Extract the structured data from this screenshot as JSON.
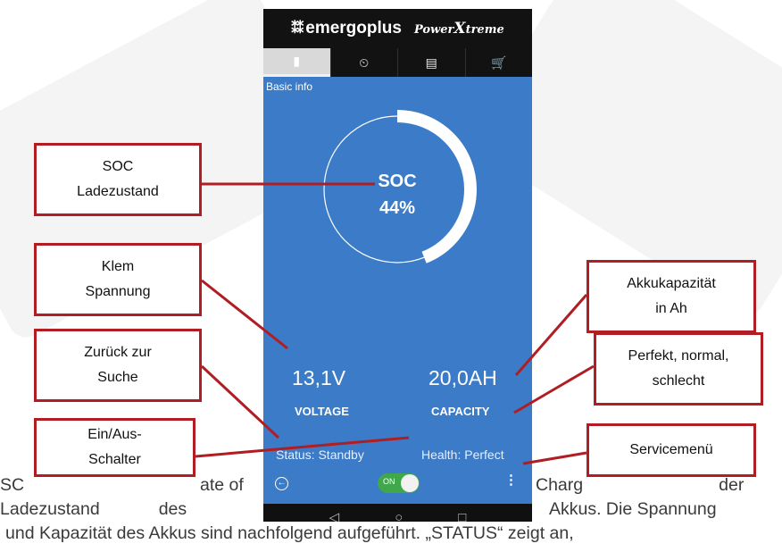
{
  "app": {
    "brand": "emergoplus",
    "brand_product_prefix": "Power",
    "brand_product_x": "X",
    "brand_product_suffix": "treme"
  },
  "tabs": [
    {
      "icon": "battery-icon",
      "glyph": "▮",
      "active": true
    },
    {
      "icon": "speedometer-icon",
      "glyph": "⏲",
      "active": false
    },
    {
      "icon": "document-settings-icon",
      "glyph": "▤",
      "active": false
    },
    {
      "icon": "cart-icon",
      "glyph": "🛒",
      "active": false
    }
  ],
  "main": {
    "section_label": "Basic info",
    "soc_label": "SOC",
    "soc_value": "44%",
    "soc_fraction": 0.44,
    "voltage_value": "13,1V",
    "voltage_label": "VOLTAGE",
    "capacity_value": "20,0AH",
    "capacity_label": "CAPACITY",
    "status": "Status: Standby",
    "health": "Health: Perfect",
    "toggle_label": "ON",
    "toggle_on": true
  },
  "navbar": {
    "back": "◁",
    "home": "○",
    "recents": "□"
  },
  "callouts": {
    "soc": "SOC\nLadezustand",
    "klem": "Klem\nSpannung",
    "zuruck": "Zurück zur\nSuche",
    "einaus": "Ein/Aus-\nSchalter",
    "kapazitat": "Akkukapazität\nin Ah",
    "perfekt": "Perfekt, normal,\nschlecht",
    "service": "Servicemenü"
  },
  "paragraph": {
    "line1_left": "SC",
    "line1_mid": "ate of",
    "line1_right": "Charg",
    "line1_end": "der",
    "line2_w1": "Ladezustand",
    "line2_w2": "des",
    "line2_right": "Akkus. Die Spannung",
    "line3": "und Kapazität des Akkus sind nachfolgend aufgeführt. „STATUS“ zeigt an,"
  },
  "colors": {
    "accent_blue": "#3b7bc7",
    "annotation_red": "#b01e23",
    "toggle_green": "#3ea84a"
  }
}
